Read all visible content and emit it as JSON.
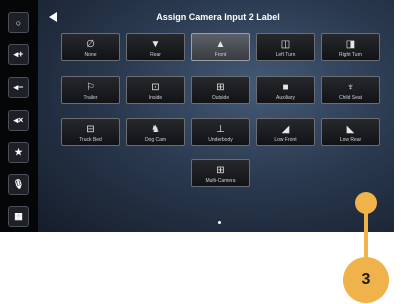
{
  "screen": {
    "title": "Assign Camera Input 2 Label",
    "page_indicator": {
      "current": 1,
      "total": 1
    }
  },
  "sidebar": {
    "buttons": [
      {
        "icon": "circle-home-icon",
        "glyph": "○"
      },
      {
        "icon": "volume-up-icon",
        "glyph": "◂+"
      },
      {
        "icon": "volume-down-icon",
        "glyph": "◂−"
      },
      {
        "icon": "mute-icon",
        "glyph": "◂×"
      },
      {
        "icon": "star-icon",
        "glyph": "★"
      },
      {
        "icon": "microphone-icon",
        "glyph": "🎙"
      },
      {
        "icon": "app-grid-icon",
        "glyph": "▦"
      }
    ]
  },
  "tiles": [
    {
      "label": "None",
      "icon": "none-icon",
      "glyph": "∅"
    },
    {
      "label": "Rear",
      "icon": "rear-icon",
      "glyph": "▼"
    },
    {
      "label": "Front",
      "icon": "front-icon",
      "glyph": "▲",
      "selected": true
    },
    {
      "label": "Left Turn",
      "icon": "left-turn-icon",
      "glyph": "◫"
    },
    {
      "label": "Right Turn",
      "icon": "right-turn-icon",
      "glyph": "◨"
    },
    {
      "label": "Trailer",
      "icon": "trailer-icon",
      "glyph": "⚐"
    },
    {
      "label": "Inside",
      "icon": "inside-icon",
      "glyph": "⊡"
    },
    {
      "label": "Outside",
      "icon": "outside-icon",
      "glyph": "⊞"
    },
    {
      "label": "Auxiliary",
      "icon": "auxiliary-camera-icon",
      "glyph": "■"
    },
    {
      "label": "Child Seat",
      "icon": "child-seat-icon",
      "glyph": "♆"
    },
    {
      "label": "Truck Bed",
      "icon": "truck-bed-icon",
      "glyph": "⊟"
    },
    {
      "label": "Dog Cam",
      "icon": "dog-cam-icon",
      "glyph": "♞"
    },
    {
      "label": "Underbody",
      "icon": "underbody-icon",
      "glyph": "⊥"
    },
    {
      "label": "Low Front",
      "icon": "low-front-icon",
      "glyph": "◢"
    },
    {
      "label": "Low Rear",
      "icon": "low-rear-icon",
      "glyph": "◣"
    },
    {
      "label": "Multi-Camera",
      "icon": "multi-camera-icon",
      "glyph": "⊞"
    }
  ],
  "callout": {
    "number": "3",
    "color": "#f0b24a"
  }
}
